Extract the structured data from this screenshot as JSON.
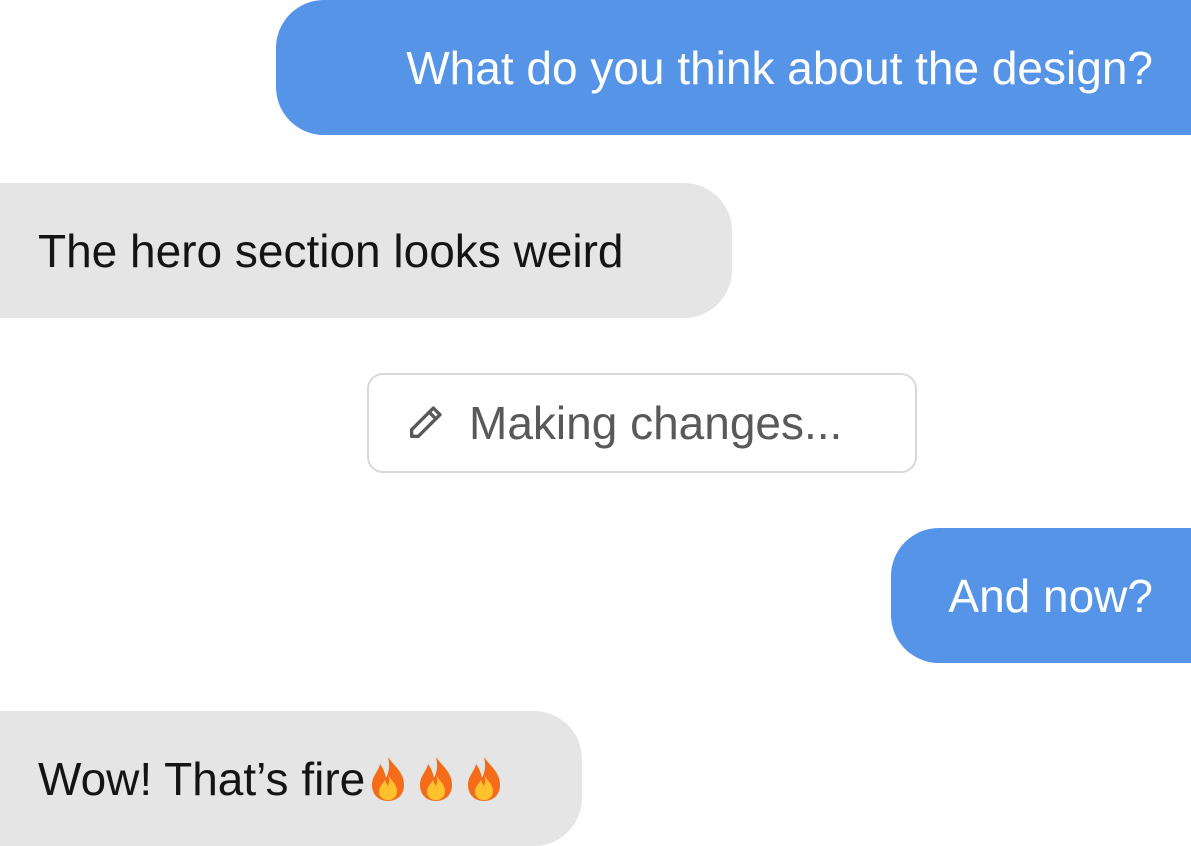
{
  "conversation": {
    "messages": [
      {
        "role": "user",
        "text": "What do you think about the design?"
      },
      {
        "role": "assistant",
        "text": "The hero section looks weird"
      },
      {
        "role": "user",
        "text": "And now?"
      },
      {
        "role": "assistant",
        "text": "Wow! That’s fire",
        "emoji": [
          "fire-icon",
          "fire-icon",
          "fire-icon"
        ]
      }
    ],
    "status": {
      "icon": "pencil-icon",
      "text": "Making changes..."
    }
  },
  "colors": {
    "outgoing_bubble": "#5694e8",
    "incoming_bubble": "#e5e5e5",
    "status_border": "#d9d9d9",
    "status_text": "#595959"
  }
}
